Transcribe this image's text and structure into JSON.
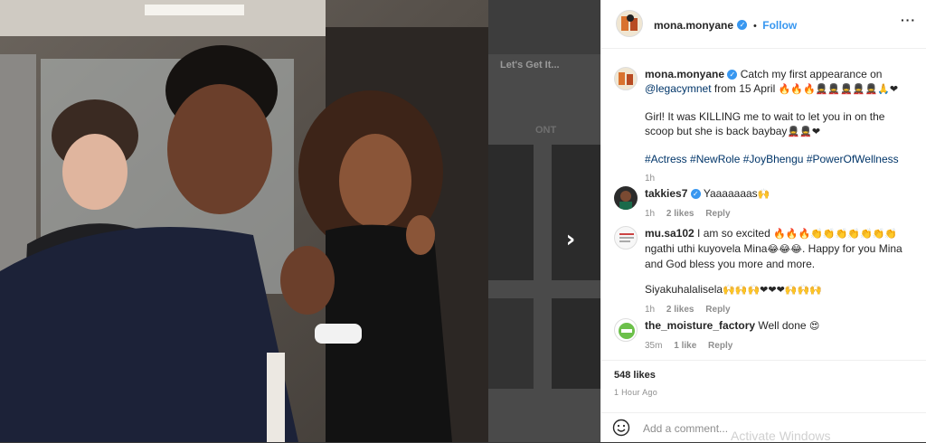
{
  "theme": {
    "accent": "#3897f0",
    "link": "#003569",
    "muted": "#8e8e8e",
    "text": "#262626"
  },
  "backdrop": {
    "left_title": "Let's Get It...",
    "right_title": "ONT"
  },
  "post": {
    "author": "mona.monyane",
    "follow_label": "Follow",
    "separator": "•",
    "more_icon": "more-options-icon",
    "next_icon": "chevron-right-icon"
  },
  "caption": {
    "author": "mona.monyane",
    "line1": "Catch my first appearance on",
    "mention": "@legacymnet",
    "line2": "from 15 April",
    "emoji1": "🔥🔥🔥💂💂💂💂💂🙏❤",
    "para2": "Girl! It was KILLING me to wait to let you in on the scoop but she is back baybay",
    "emoji2": "💂💂❤",
    "hashtags": [
      "#Actress",
      "#NewRole",
      "#JoyBhengu",
      "#PowerOfWellness"
    ],
    "time": "1h"
  },
  "comments": [
    {
      "author": "takkies7",
      "verified": true,
      "text": "Yaaaaaaas",
      "emoji": "🙌",
      "time": "1h",
      "likes": "2 likes",
      "reply": "Reply"
    },
    {
      "author": "mu.sa102",
      "verified": false,
      "text": "I am so excited",
      "emoji": "🔥🔥🔥👏👏👏👏👏👏👏",
      "text2": "ngathi uthi kuyovela Mina",
      "emoji2": "😂😂😂",
      "text3": ". Happy for you Mina and God bless you more and more.",
      "text4": "Siyakuhalalisela",
      "emoji4": "🙌🙌🙌❤❤❤🙌🙌🙌",
      "time": "1h",
      "likes": "2 likes",
      "reply": "Reply"
    },
    {
      "author": "the_moisture_factory",
      "verified": false,
      "text": "Well done",
      "emoji": "😍",
      "time": "35m",
      "likes": "1 like",
      "reply": "Reply"
    }
  ],
  "likes": "548 likes",
  "time_ago": "1 Hour Ago",
  "comment_box": {
    "placeholder": "Add a comment...",
    "icon": "smile-icon"
  },
  "watermark": "Activate Windows"
}
